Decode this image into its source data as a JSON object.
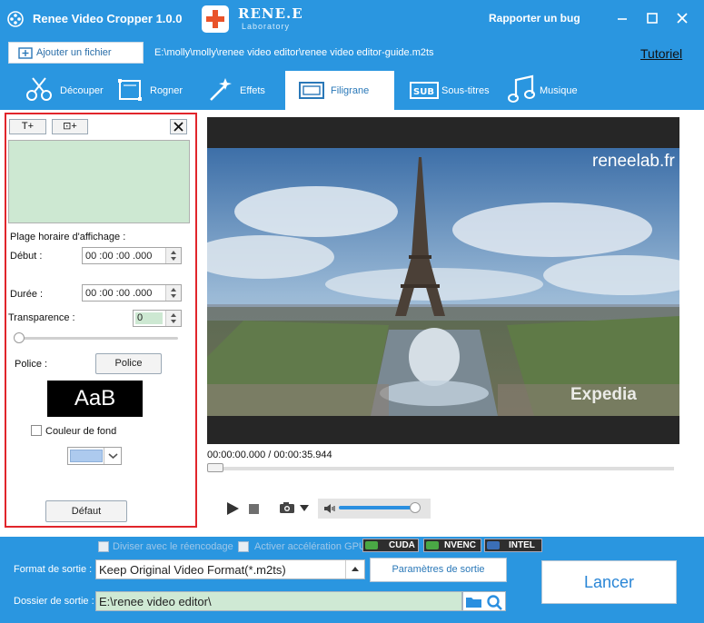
{
  "window": {
    "title": "Renee Video Cropper 1.0.0",
    "logo_name": "RENE.E",
    "logo_sub": "Laboratory",
    "report_bug": "Rapporter un bug",
    "controls": [
      "minimize-icon",
      "maximize-icon",
      "close-icon"
    ]
  },
  "toolbar": {
    "add_file": "Ajouter un fichier",
    "file_path": "E:\\molly\\molly\\renee video editor\\renee video editor-guide.m2ts",
    "tutorial": "Tutoriel"
  },
  "tabs": [
    {
      "label": "Découper",
      "icon": "scissors-icon"
    },
    {
      "label": "Rogner",
      "icon": "crop-icon"
    },
    {
      "label": "Effets",
      "icon": "magic-wand-icon"
    },
    {
      "label": "Filigrane",
      "icon": "watermark-icon",
      "active": true
    },
    {
      "label": "Sous-titres",
      "icon": "subtitle-icon"
    },
    {
      "label": "Musique",
      "icon": "music-note-icon"
    }
  ],
  "watermark_panel": {
    "add_text_btn": "T+",
    "add_image_btn": "⊡+",
    "schedule_label": "Plage horaire d'affichage :",
    "start_label": "Début :",
    "start_value": "00 :00 :00 .000",
    "duration_label": "Durée :",
    "duration_value": "00 :00 :00 .000",
    "transparency_label": "Transparence :",
    "transparency_value": "0",
    "transparency_slider": 0,
    "font_label": "Police :",
    "font_button": "Police",
    "font_sample": "AaB",
    "bg_color_label": "Couleur de fond",
    "bg_color_checked": false,
    "bg_color_value": "#adcaee",
    "default_button": "Défaut"
  },
  "player": {
    "video_watermark": "reneelab.fr",
    "video_logo": "Expedia",
    "time_readout": "00:00:00.000 / 00:00:35.944",
    "seek_position": 0,
    "volume_level": 0.85
  },
  "output": {
    "split_reencode_label": "Diviser avec le réencodage",
    "gpu_accel_label": "Activer accélération GPU",
    "gpu_badges": [
      "CUDA",
      "NVENC",
      "INTEL"
    ],
    "format_label": "Format de sortie :",
    "format_value": "Keep Original Video Format(*.m2ts)",
    "params_button": "Paramètres de sortie",
    "folder_label": "Dossier de sortie :",
    "folder_value": "E:\\renee video editor\\",
    "launch_button": "Lancer"
  },
  "colors": {
    "accent": "#2a96e0",
    "highlight_border": "#e1252b",
    "logo_cross": "#e9532a"
  }
}
